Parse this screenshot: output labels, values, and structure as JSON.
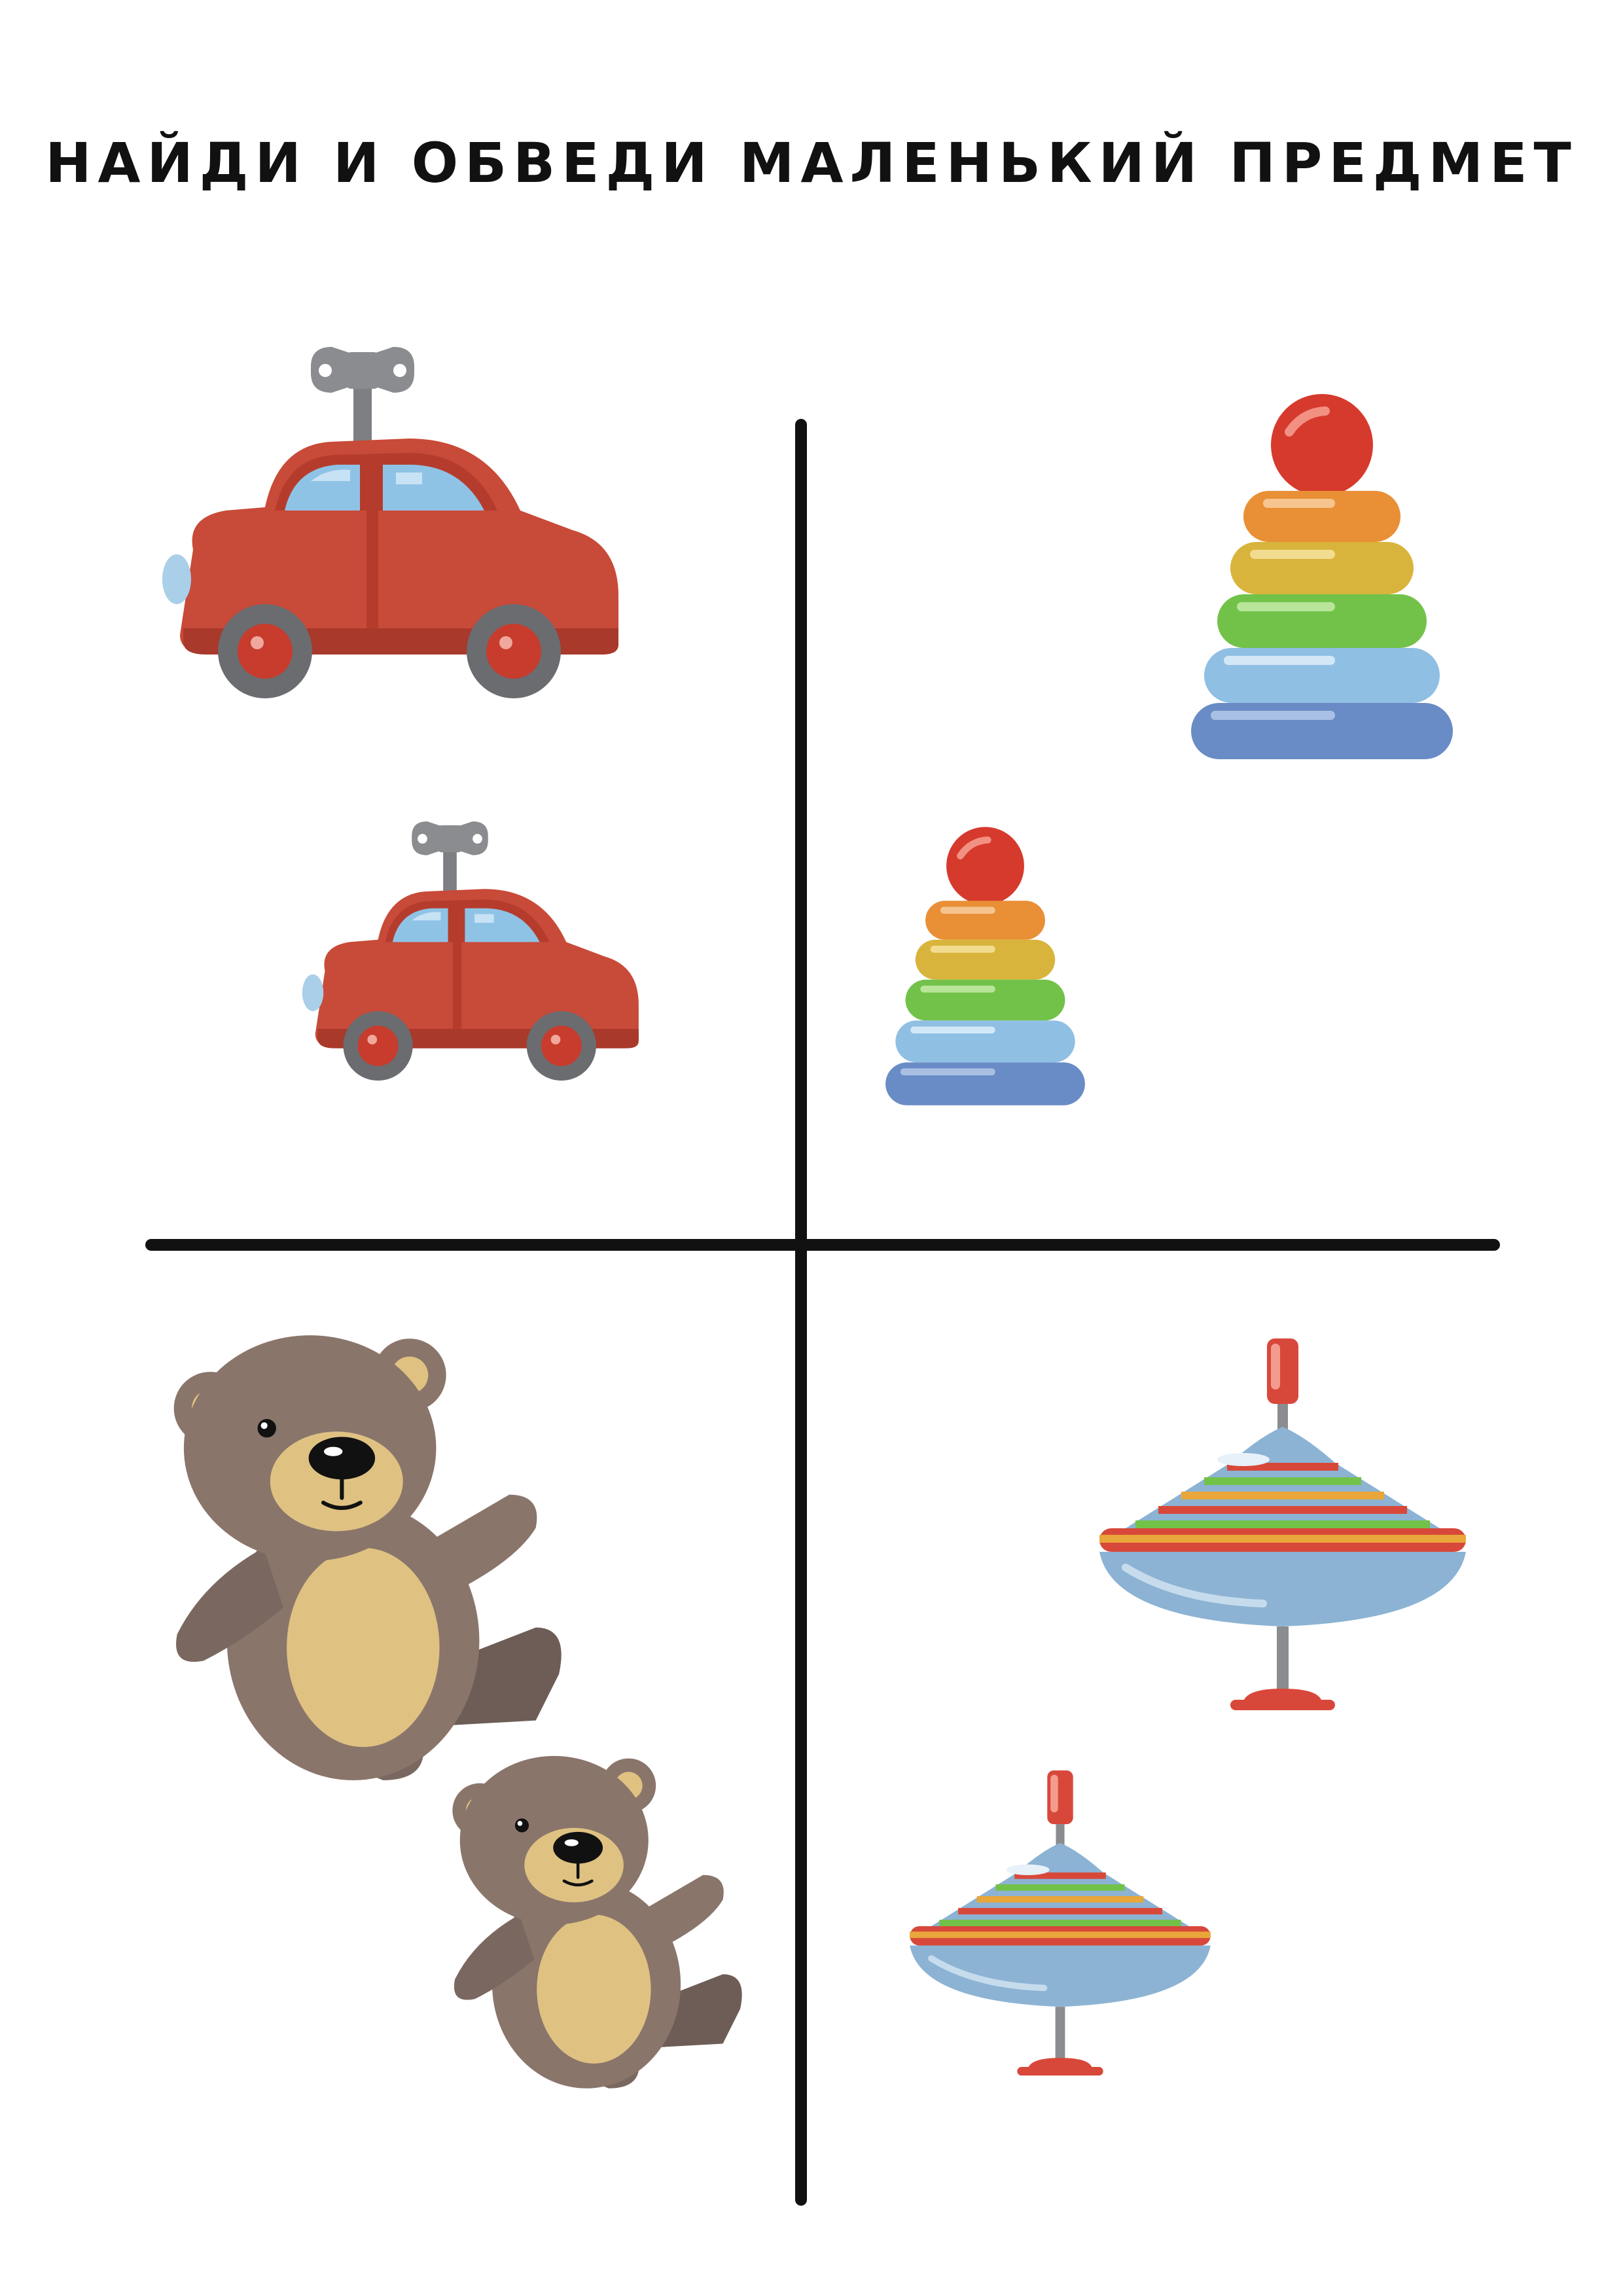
{
  "worksheet": {
    "title": "НАЙДИ И ОБВЕДИ МАЛЕНЬКИЙ ПРЕДМЕТ"
  },
  "quadrants": [
    {
      "name": "cars",
      "items": [
        {
          "icon": "toy-car-icon",
          "size": "large"
        },
        {
          "icon": "toy-car-icon",
          "size": "small"
        }
      ]
    },
    {
      "name": "pyramids",
      "items": [
        {
          "icon": "stacking-rings-icon",
          "size": "large"
        },
        {
          "icon": "stacking-rings-icon",
          "size": "small"
        }
      ]
    },
    {
      "name": "bears",
      "items": [
        {
          "icon": "teddy-bear-icon",
          "size": "large"
        },
        {
          "icon": "teddy-bear-icon",
          "size": "small"
        }
      ]
    },
    {
      "name": "spinning-tops",
      "items": [
        {
          "icon": "spinning-top-icon",
          "size": "large"
        },
        {
          "icon": "spinning-top-icon",
          "size": "small"
        }
      ]
    }
  ],
  "colors": {
    "divider": "#111111",
    "car_body": "#c84a38",
    "car_window": "#8fc3e6",
    "ring_colors": [
      "#6a8cc6",
      "#8fbfe3",
      "#72c24a",
      "#d9b43c",
      "#e98f36"
    ],
    "ball": "#d63a2c",
    "bear_fur": "#8a756b",
    "bear_belly": "#dfc282",
    "top_body": "#8cb3d3"
  }
}
